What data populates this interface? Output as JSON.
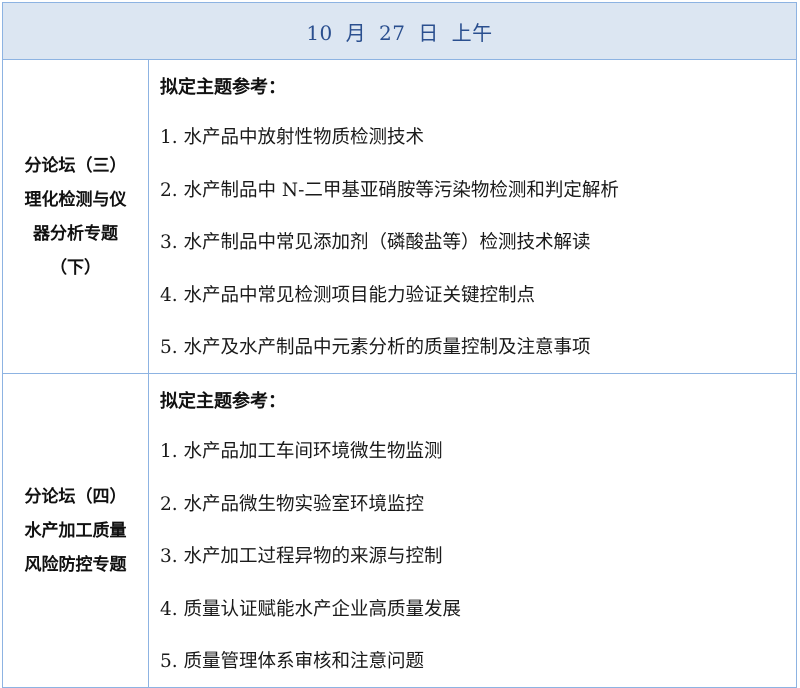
{
  "header": {
    "title": "10 月 27 日  上午"
  },
  "rows": [
    {
      "label_lines": [
        "分论坛（三）",
        "理化检测与仪",
        "器分析专题",
        "（下）"
      ],
      "heading": "拟定主题参考：",
      "topics": [
        "1. 水产品中放射性物质检测技术",
        "2. 水产制品中 N-二甲基亚硝胺等污染物检测和判定解析",
        "3. 水产制品中常见添加剂（磷酸盐等）检测技术解读",
        "4. 水产品中常见检测项目能力验证关键控制点",
        "5. 水产及水产制品中元素分析的质量控制及注意事项"
      ]
    },
    {
      "label_lines": [
        "分论坛（四）",
        "水产加工质量",
        "风险防控专题"
      ],
      "heading": "拟定主题参考：",
      "topics": [
        "1. 水产品加工车间环境微生物监测",
        "2. 水产品微生物实验室环境监控",
        "3. 水产加工过程异物的来源与控制",
        "4. 质量认证赋能水产企业高质量发展",
        "5. 质量管理体系审核和注意问题"
      ]
    }
  ],
  "colors": {
    "border": "#8db3e2",
    "header_bg": "#dce6f2",
    "header_text": "#2a4f8f"
  }
}
